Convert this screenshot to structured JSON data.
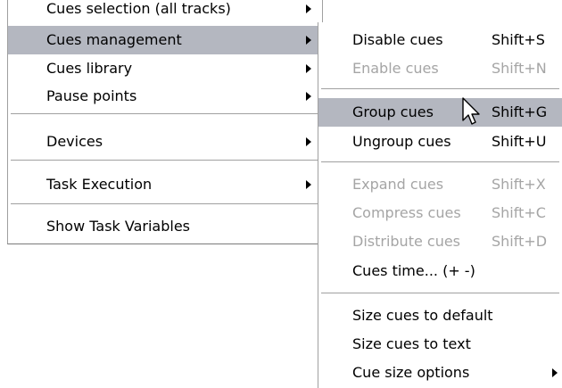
{
  "main_menu": {
    "items": [
      {
        "label": "Cues selection (all tracks)"
      },
      {
        "label": "Cues management"
      },
      {
        "label": "Cues library"
      },
      {
        "label": "Pause points"
      },
      {
        "label": "Devices"
      },
      {
        "label": "Task Execution"
      },
      {
        "label": "Show Task Variables"
      }
    ]
  },
  "sub_menu": {
    "items": [
      {
        "label": "Disable cues",
        "shortcut": "Shift+S"
      },
      {
        "label": "Enable cues",
        "shortcut": "Shift+N"
      },
      {
        "label": "Group cues",
        "shortcut": "Shift+G"
      },
      {
        "label": "Ungroup cues",
        "shortcut": "Shift+U"
      },
      {
        "label": "Expand cues",
        "shortcut": "Shift+X"
      },
      {
        "label": "Compress cues",
        "shortcut": "Shift+C"
      },
      {
        "label": "Distribute cues",
        "shortcut": "Shift+D"
      },
      {
        "label": "Cues time... (+ -)"
      },
      {
        "label": "Size cues to default"
      },
      {
        "label": "Size cues to text"
      },
      {
        "label": "Cue size options"
      }
    ]
  },
  "colors": {
    "highlight": "#b4b7c0",
    "disabled_text": "#a5a5a5",
    "separator": "#a0a0a0"
  },
  "icons": {
    "submenu_arrow": "submenu-arrow-icon",
    "cursor": "mouse-pointer-icon"
  }
}
